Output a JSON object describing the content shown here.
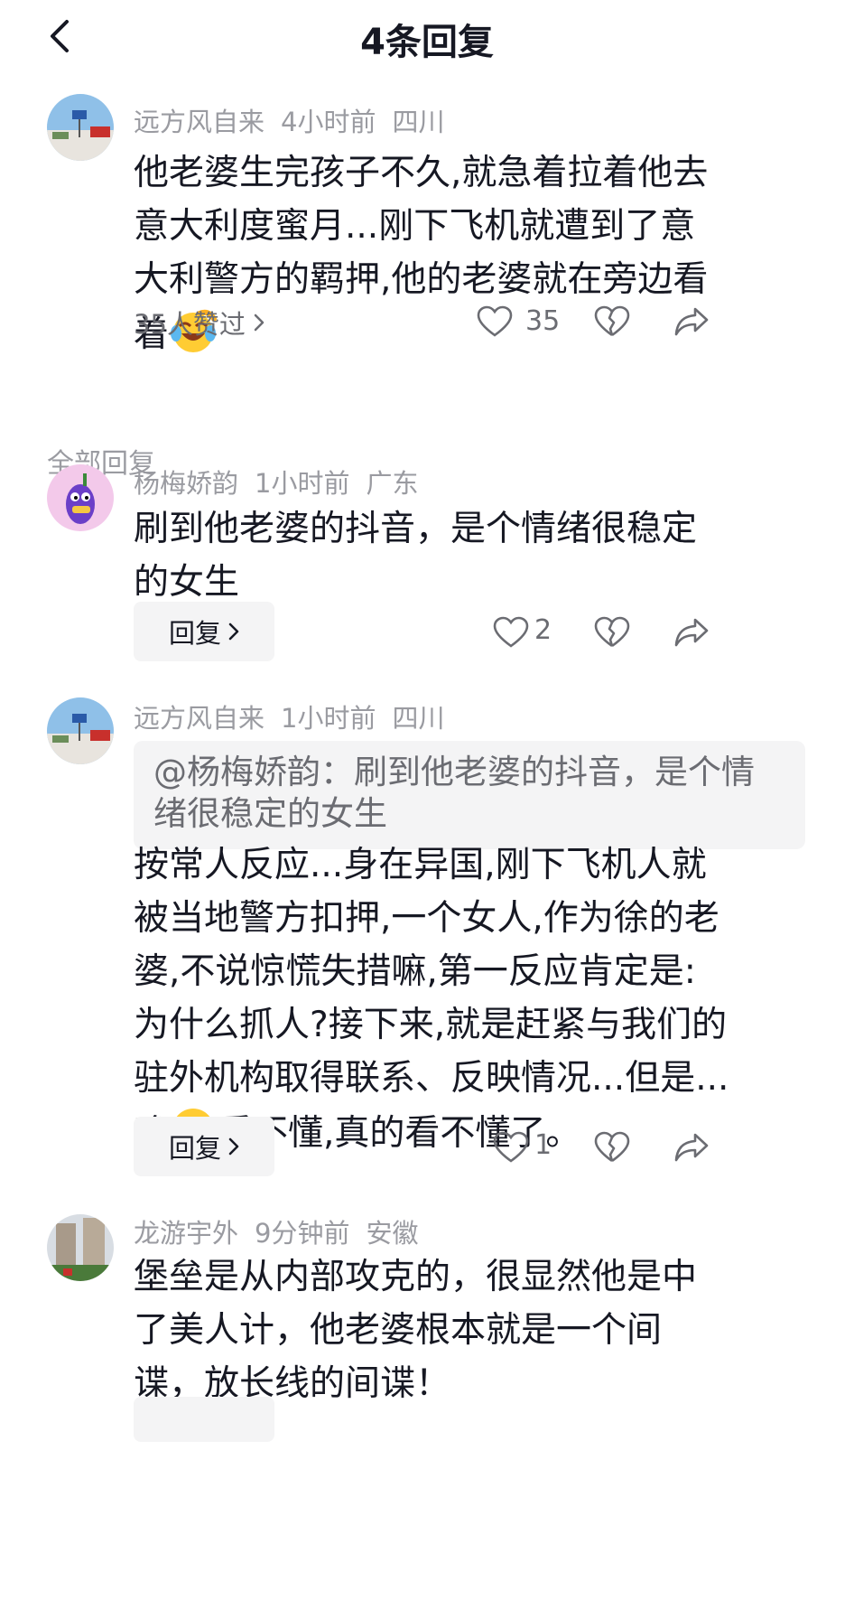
{
  "header": {
    "title": "4条回复",
    "back_icon": "chevron-left-icon"
  },
  "parent_comment": {
    "author": "远方风自来",
    "time": "4小时前",
    "location": "四川",
    "text": "他老婆生完孩子不久,就急着拉着他去意大利度蜜月...刚下飞机就遭到了意大利警方的羁押,他的老婆就在旁边看着",
    "emoji": "crying-laughing-emoji",
    "liked_by": "35人赞过",
    "like_count": "35"
  },
  "section_label": "全部回复",
  "replies": [
    {
      "author": "杨梅娇韵",
      "time": "1小时前",
      "location": "广东",
      "text": "刷到他老婆的抖音，是个情绪很稳定的女生",
      "reply_label": "回复",
      "like_count": "2"
    },
    {
      "author": "远方风自来",
      "time": "1小时前",
      "location": "四川",
      "quote": "@杨梅娇韵：刷到他老婆的抖音，是个情绪很稳定的女生",
      "text_before_emoji": "按常人反应...身在异国,刚下飞机人就被当地警方扣押,一个女人,作为徐的老婆,不说惊慌失措嘛,第一反应肯定是:为什么抓人?接下来,就是赶紧与我们的驻外机构取得联系、反映情况...但是...唉",
      "emoji": "pensive-emoji",
      "text_after_emoji": "看不懂,真的看不懂了。",
      "reply_label": "回复",
      "like_count": "1"
    },
    {
      "author": "龙游宇外",
      "time": "9分钟前",
      "location": "安徽",
      "text": "堡垒是从内部攻克的，很显然他是中了美人计，他老婆根本就是一个间谍，放长线的间谍！"
    }
  ],
  "colors": {
    "text_primary": "#161823",
    "text_meta": "#9a9ba1",
    "text_secondary": "#6b6c72",
    "button_bg": "#f4f4f5"
  }
}
